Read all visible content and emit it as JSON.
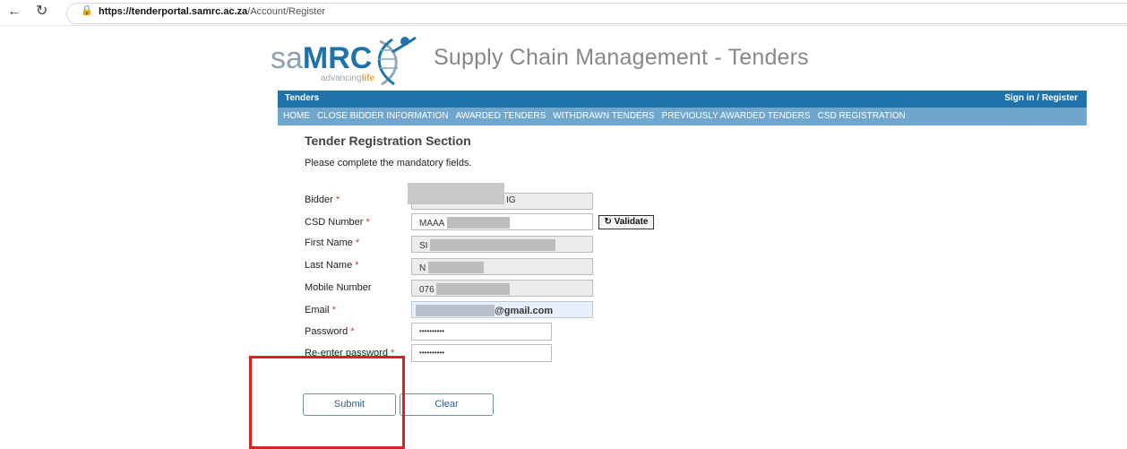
{
  "browser": {
    "back_icon": "←",
    "reload_icon": "↻",
    "lock_icon": "🔒",
    "url_host": "https://tenderportal.samrc.ac.za",
    "url_path": "/Account/Register"
  },
  "logo": {
    "text_sa": "sa",
    "text_mrc": "MRC",
    "tagline_prefix": "advancing",
    "tagline_suffix": "life"
  },
  "header": {
    "site_title": "Supply Chain Management - Tenders",
    "brand_link": "Tenders",
    "signin_link": "Sign in / Register"
  },
  "menu": [
    "HOME",
    "CLOSE BIDDER INFORMATION",
    "AWARDED TENDERS",
    "WITHDRAWN TENDERS",
    "PREVIOUSLY AWARDED TENDERS",
    "CSD REGISTRATION"
  ],
  "form": {
    "section_title": "Tender Registration Section",
    "instructions": "Please complete the mandatory fields.",
    "required_marker": "*",
    "fields": {
      "bidder": {
        "label": "Bidder",
        "value_suffix": "IG"
      },
      "csd": {
        "label": "CSD Number",
        "value_prefix": "MAAA"
      },
      "first_name": {
        "label": "First Name",
        "value_prefix": "SI"
      },
      "last_name": {
        "label": "Last Name",
        "value_prefix": "N"
      },
      "mobile": {
        "label": "Mobile Number",
        "value_prefix": "076"
      },
      "email": {
        "label": "Email",
        "value_suffix": "@gmail.com"
      },
      "password": {
        "label": "Password",
        "value": "••••••••••"
      },
      "reenter": {
        "label": "Re-enter password",
        "value": "••••••••••"
      }
    },
    "validate_icon": "↻",
    "validate_label": "Validate",
    "submit_label": "Submit",
    "clear_label": "Clear"
  },
  "colors": {
    "topbar": "#1f72aa",
    "menubar": "#6ea6cd",
    "required": "#d9342b",
    "highlight": "#e02020"
  }
}
